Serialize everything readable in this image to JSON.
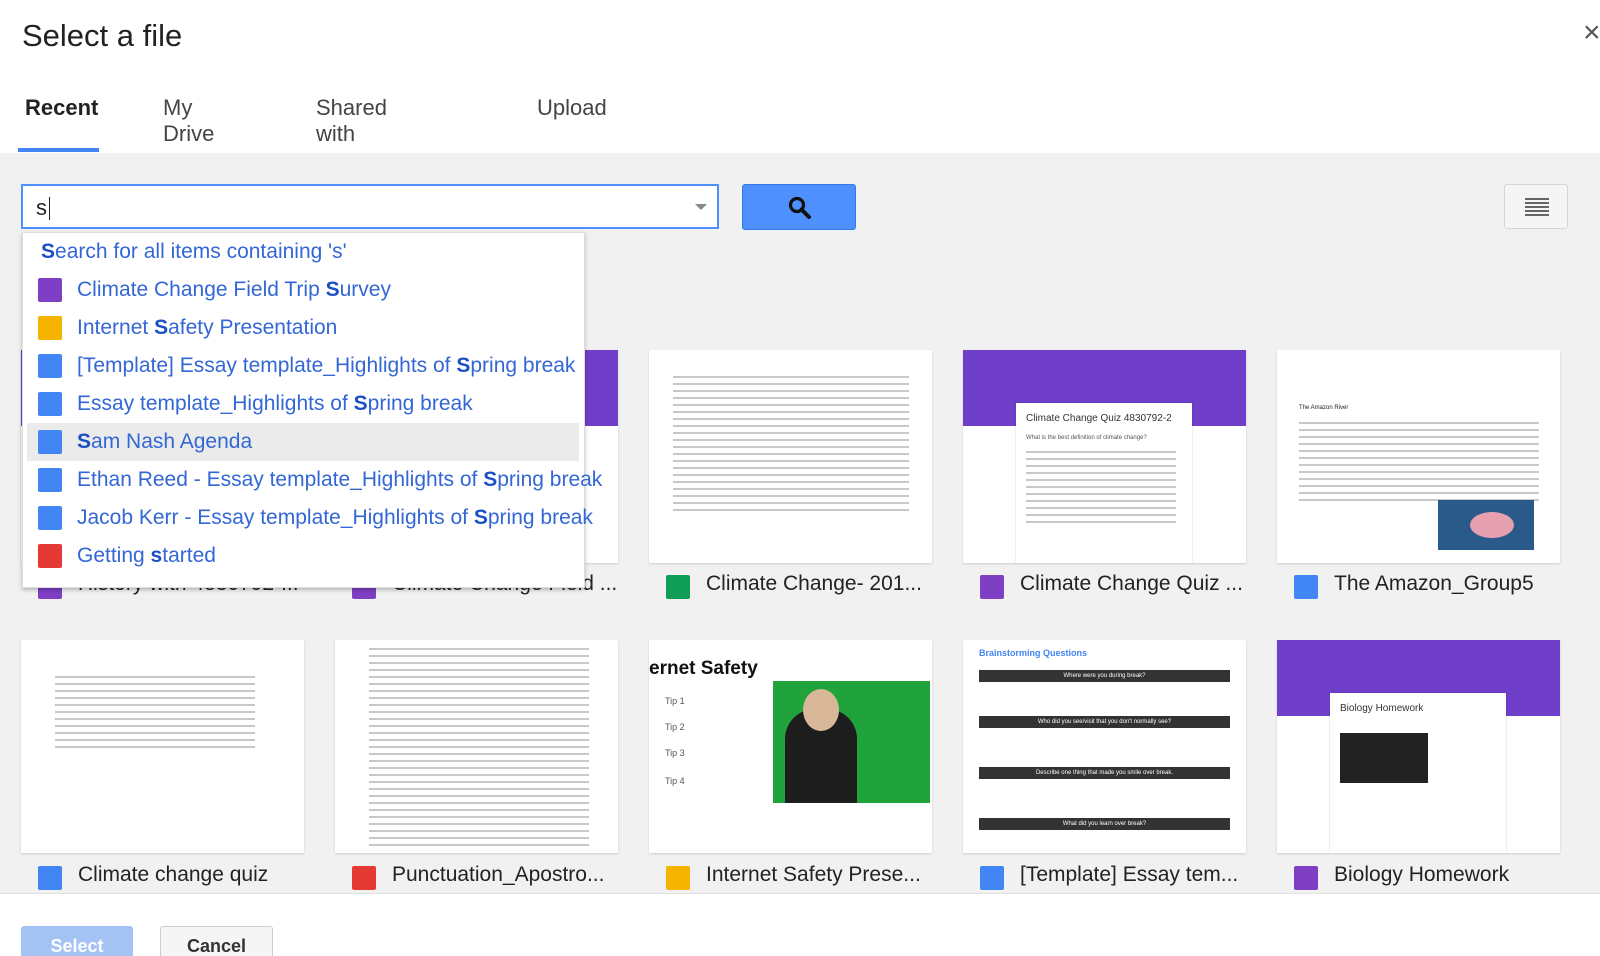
{
  "dialog": {
    "title": "Select a file",
    "close_glyph": "×"
  },
  "tabs": [
    {
      "label": "Recent",
      "active": true
    },
    {
      "label": "My Drive",
      "active": false
    },
    {
      "label": "Shared with me",
      "active": false
    },
    {
      "label": "Upload",
      "active": false
    }
  ],
  "search": {
    "value": "s",
    "button_icon": "search-icon",
    "view_icon": "list-view-icon"
  },
  "autocomplete": {
    "search_all_prefix": "S",
    "search_all_rest": "earch for all items containing 's'",
    "items": [
      {
        "pre": "Climate Change Field Trip ",
        "match": "S",
        "post": "urvey",
        "icon": "form",
        "highlight": false
      },
      {
        "pre": "Internet ",
        "match": "S",
        "post": "afety Presentation",
        "icon": "slide",
        "highlight": false
      },
      {
        "pre": "[Template] Essay template_Highlights of ",
        "match": "S",
        "post": "pring break",
        "icon": "doc",
        "highlight": false
      },
      {
        "pre": "Essay template_Highlights of ",
        "match": "S",
        "post": "pring break",
        "icon": "doc",
        "highlight": false
      },
      {
        "pre": "",
        "match": "S",
        "post": "am Nash Agenda",
        "icon": "doc",
        "highlight": true
      },
      {
        "pre": "Ethan Reed - Essay template_Highlights of ",
        "match": "S",
        "post": "pring break",
        "icon": "doc",
        "highlight": false
      },
      {
        "pre": "Jacob Kerr - Essay template_Highlights of ",
        "match": "S",
        "post": "pring break",
        "icon": "doc",
        "highlight": false
      },
      {
        "pre": "Getting ",
        "match": "s",
        "post": "tarted",
        "icon": "pdf",
        "highlight": false
      }
    ]
  },
  "files_row1": [
    {
      "name": "History with 4830792-...",
      "icon": "form"
    },
    {
      "name": "Climate Change Field ...",
      "icon": "form"
    },
    {
      "name": "Climate Change- 201...",
      "icon": "sheet"
    },
    {
      "name": "Climate Change Quiz ...",
      "icon": "form"
    },
    {
      "name": "The Amazon_Group5",
      "icon": "doc"
    }
  ],
  "files_row2": [
    {
      "name": "Climate change quiz",
      "icon": "doc"
    },
    {
      "name": "Punctuation_Apostro...",
      "icon": "pdf"
    },
    {
      "name": "Internet Safety Prese...",
      "icon": "slide"
    },
    {
      "name": "[Template] Essay tem...",
      "icon": "doc"
    },
    {
      "name": "Biology Homework",
      "icon": "form"
    }
  ],
  "thumbs": {
    "quiz_title": "Climate Change Quiz 4830792-2",
    "quiz_question": "What is the best definition of climate change?",
    "amazon_header": "The Amazon River",
    "internet_safety_title": "ernet Safety",
    "internet_safety_tips": [
      "Tip 1",
      "Tip 2",
      "Tip 3",
      "Tip 4"
    ],
    "brainstorm_title": "Brainstorming Questions",
    "brainstorm_rows": [
      "Where were you during break?",
      "Who did you see/visit that you don't normally see?",
      "Describe one thing that made you smile over break.",
      "What did you learn over break?"
    ],
    "biology_title": "Biology Homework"
  },
  "footer": {
    "select_label": "Select",
    "cancel_label": "Cancel"
  },
  "colors": {
    "accent": "#4285f4",
    "form": "#7e3fc5",
    "doc": "#4285f4",
    "slide": "#f4b400",
    "sheet": "#0f9d58",
    "pdf": "#e53935"
  }
}
